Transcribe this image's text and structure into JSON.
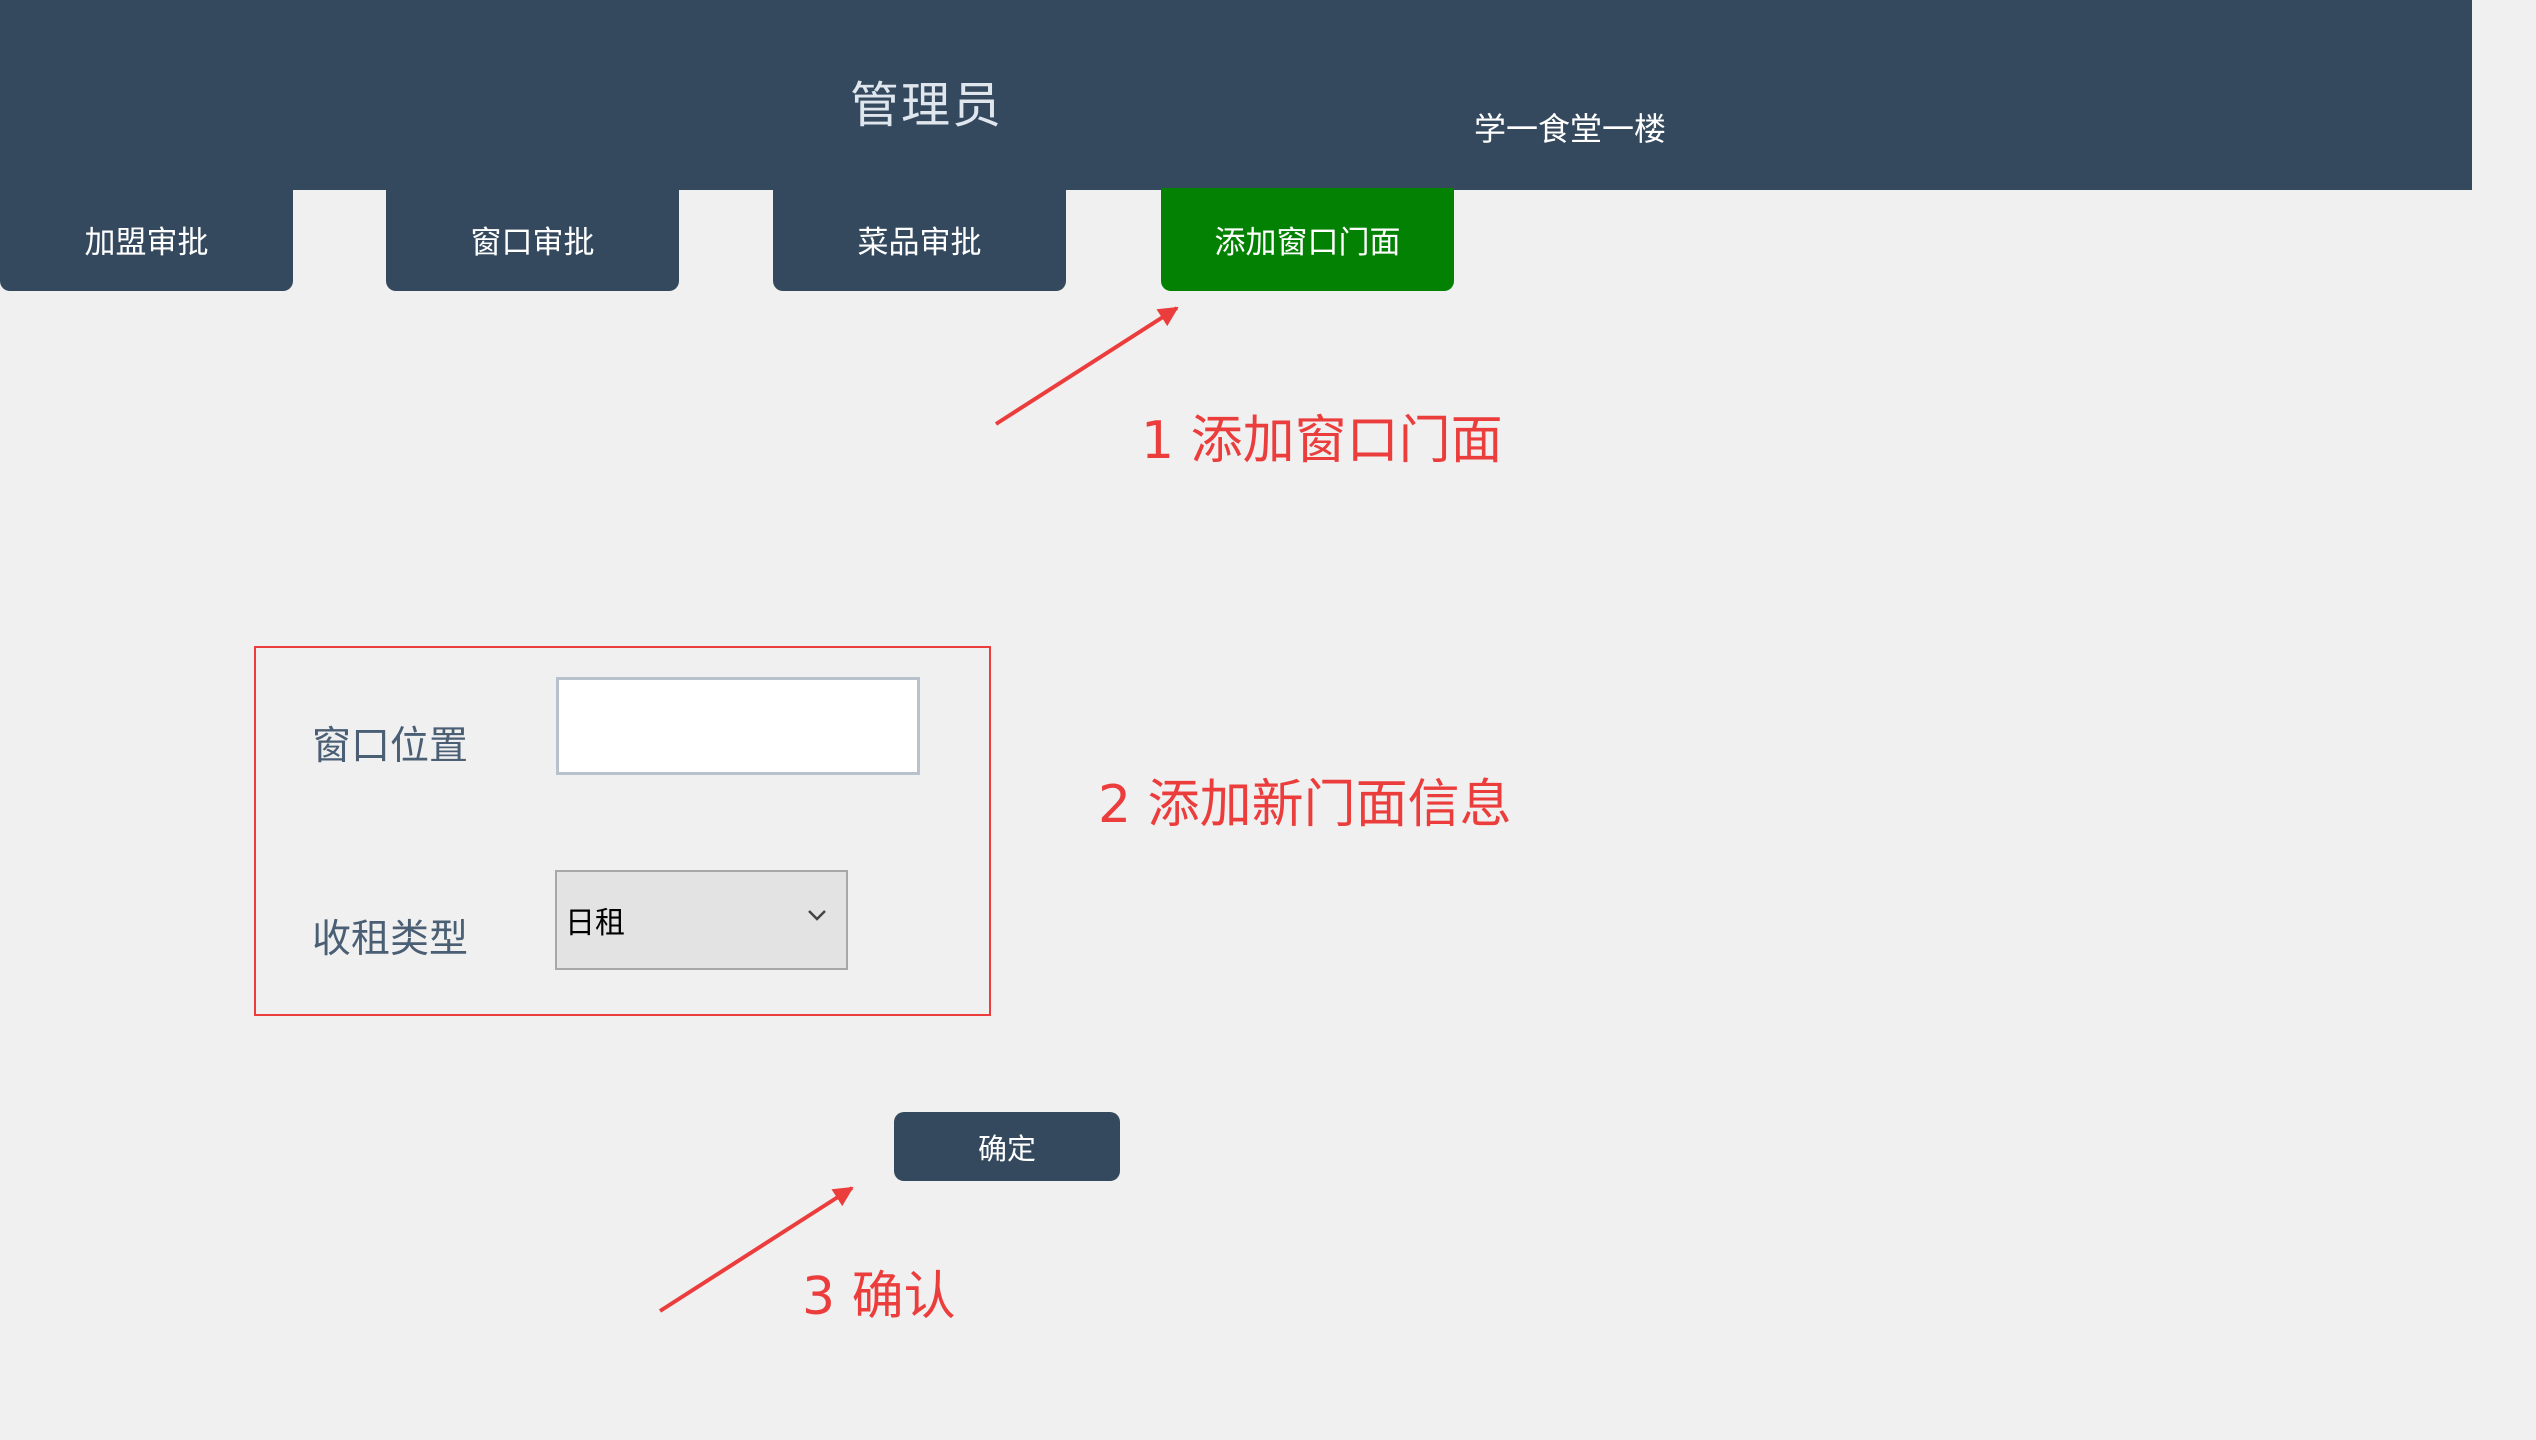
{
  "header": {
    "title": "管理员",
    "location": "学一食堂一楼"
  },
  "tabs": [
    {
      "label": "加盟审批",
      "active": false
    },
    {
      "label": "窗口审批",
      "active": false
    },
    {
      "label": "菜品审批",
      "active": false
    },
    {
      "label": "添加窗口门面",
      "active": true
    }
  ],
  "form": {
    "window_position_label": "窗口位置",
    "window_position_value": "",
    "rent_type_label": "收租类型",
    "rent_type_value": "日租",
    "confirm_label": "确定"
  },
  "annotations": {
    "step1": "1 添加窗口门面",
    "step2": "2 添加新门面信息",
    "step3": "3 确认"
  },
  "colors": {
    "header": "#34495e",
    "active_tab": "#038103",
    "annotation": "#ec3d3d",
    "background": "#f0f0f0"
  },
  "icons": {
    "select_arrow": "chevron-down-icon",
    "annotation_arrows": "arrow-icon"
  }
}
